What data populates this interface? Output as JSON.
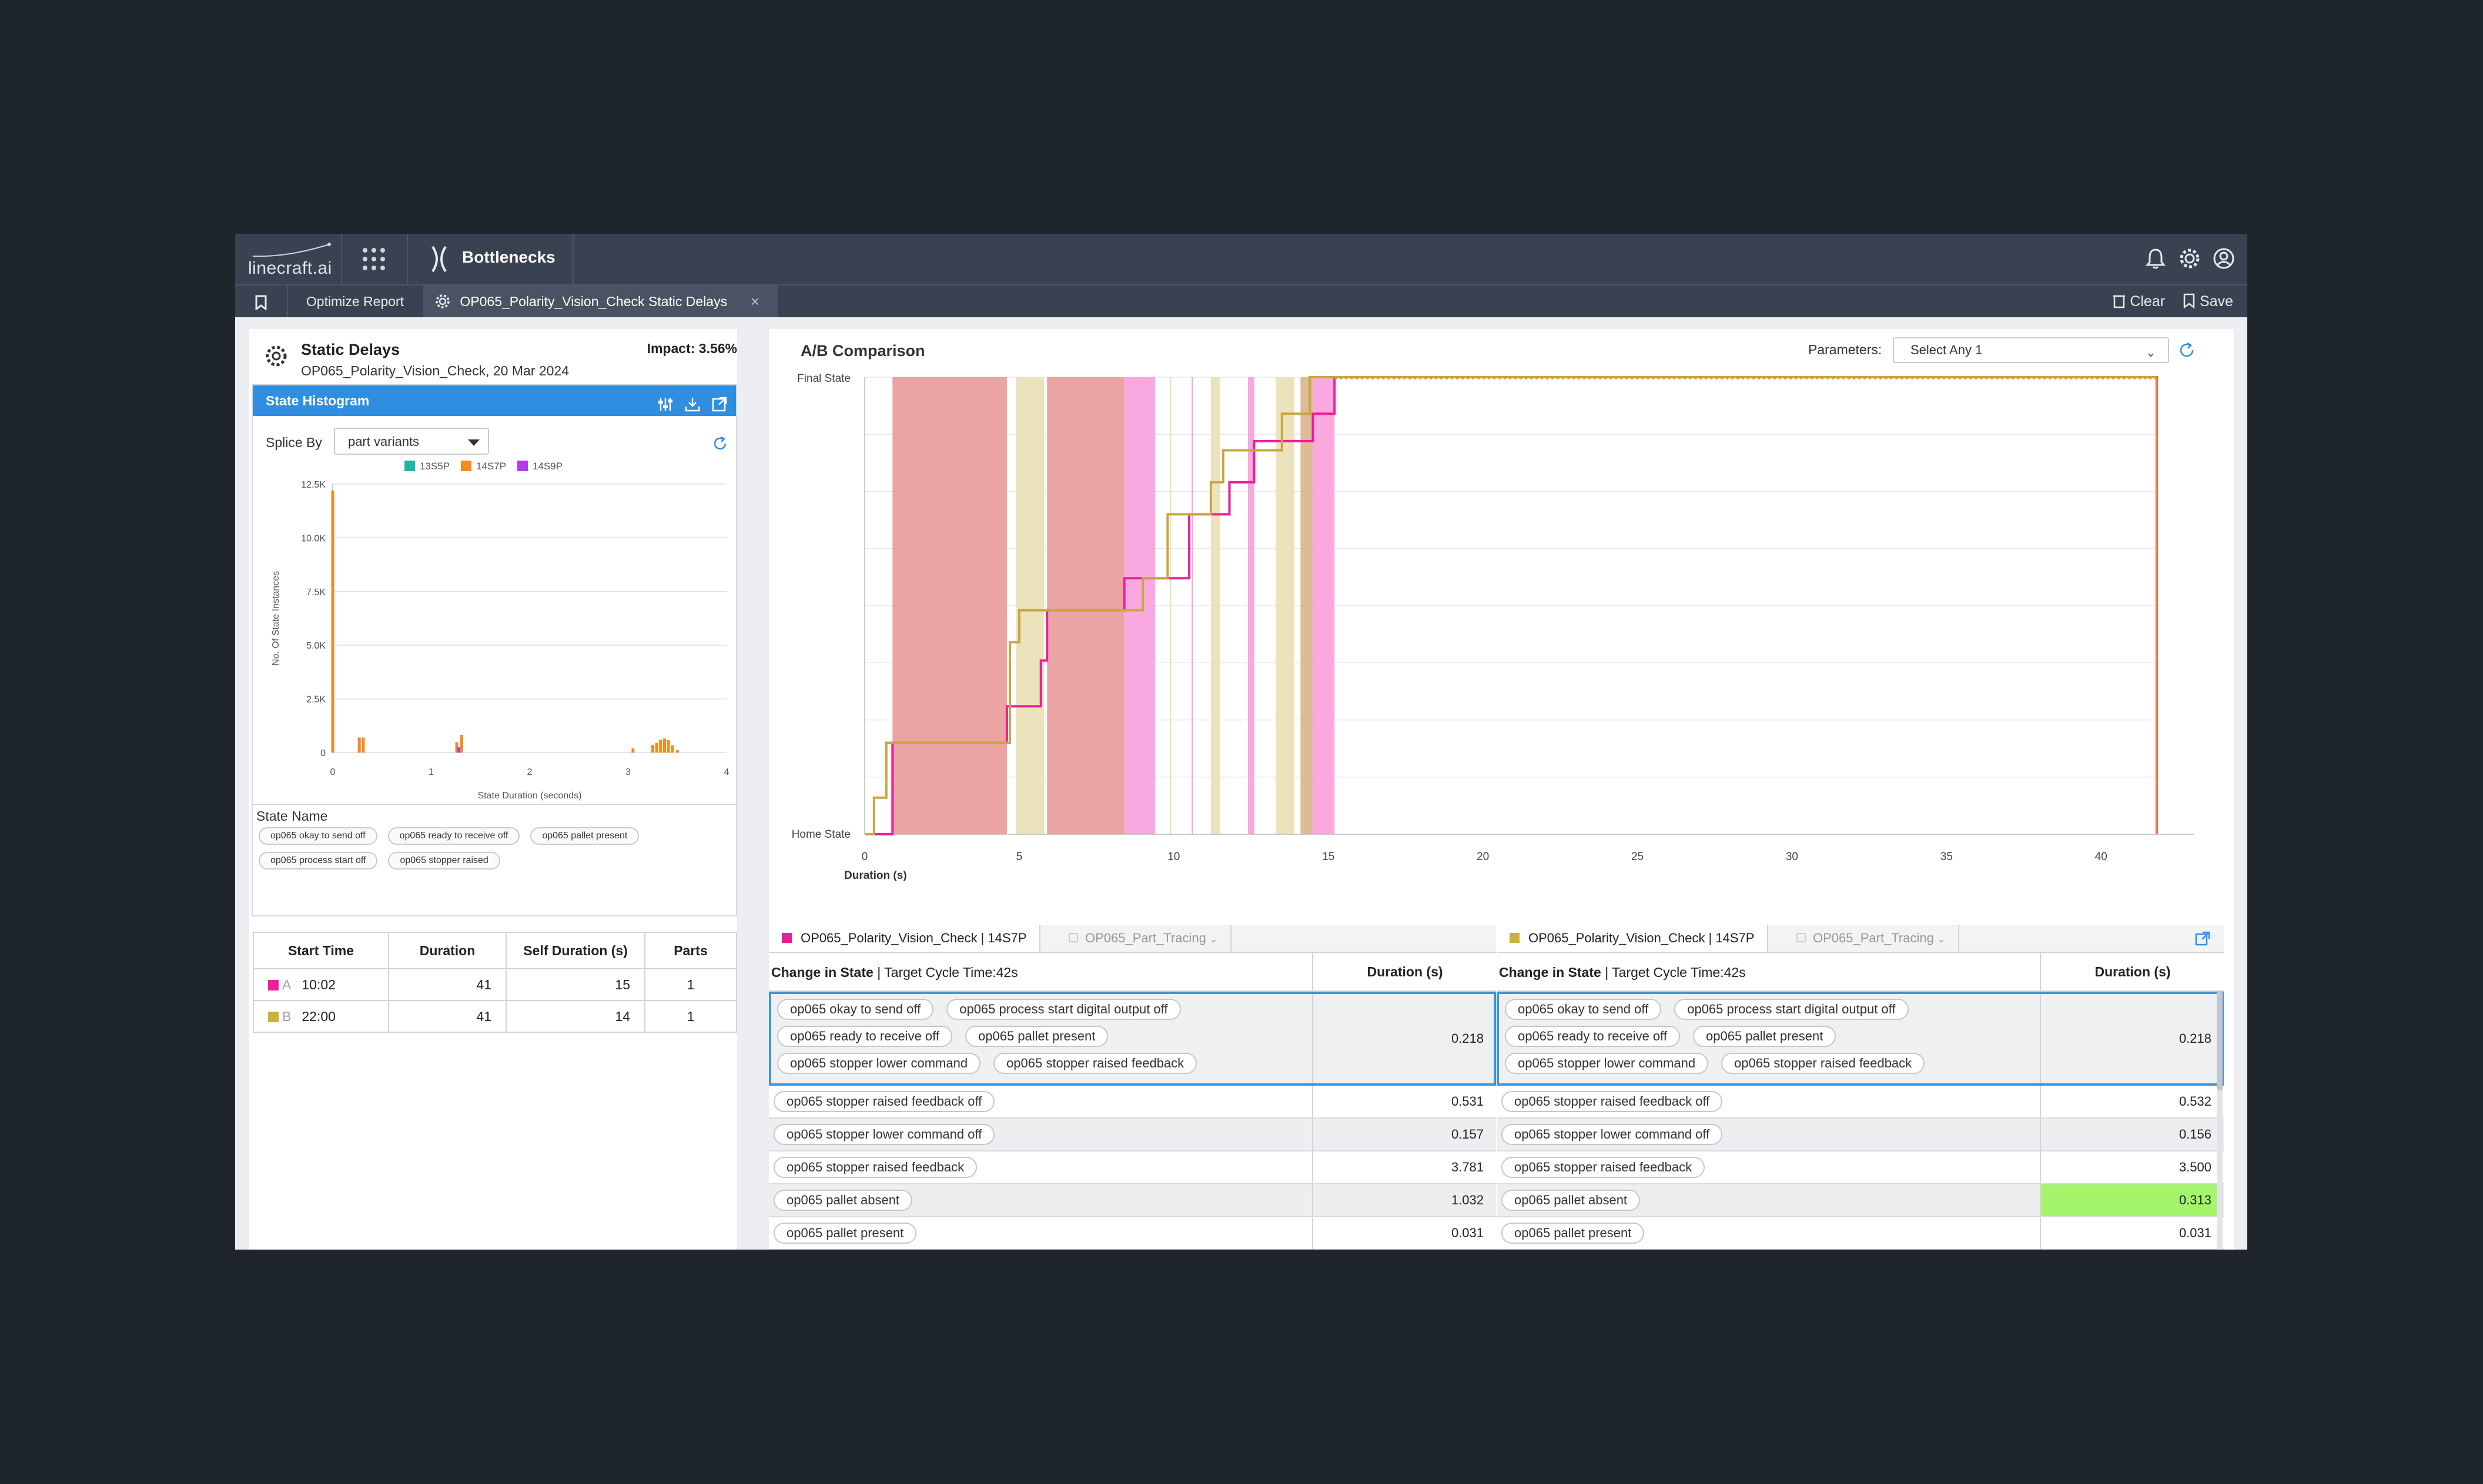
{
  "brand": {
    "logo_text": "linecraft.ai"
  },
  "header": {
    "module_title": "Bottlenecks"
  },
  "tabs": {
    "optimize": "Optimize Report",
    "active": "OP065_Polarity_Vision_Check Static Delays",
    "close": "×",
    "clear": "Clear",
    "save": "Save"
  },
  "static_delays": {
    "title": "Static Delays",
    "subtitle": "OP065_Polarity_Vision_Check, 20 Mar 2024",
    "impact": "Impact: 3.56%"
  },
  "histogram": {
    "header": "State Histogram",
    "splice_label": "Splice By",
    "splice_value": "part variants",
    "chart_data": {
      "type": "bar",
      "title": "",
      "xlabel": "State Duration (seconds)",
      "ylabel": "No. Of State Instances",
      "ylim": [
        0,
        12500
      ],
      "xlim": [
        0,
        4
      ],
      "yticks": [
        "12.5K",
        "10.0K",
        "7.5K",
        "5.0K",
        "2.5K",
        "0"
      ],
      "xticks": [
        "0",
        "1",
        "2",
        "3",
        "4"
      ],
      "legend_position": "top",
      "series": [
        {
          "name": "13S5P",
          "color": "#1bb9a3",
          "points": []
        },
        {
          "name": "14S7P",
          "color": "#f68a1e",
          "points": [
            [
              0.0,
              12200
            ],
            [
              0.27,
              700
            ],
            [
              0.31,
              700
            ],
            [
              1.26,
              480
            ],
            [
              1.31,
              820
            ],
            [
              3.25,
              350
            ],
            [
              3.29,
              450
            ],
            [
              3.33,
              600
            ],
            [
              3.37,
              650
            ],
            [
              3.41,
              580
            ],
            [
              3.45,
              340
            ],
            [
              3.05,
              200
            ],
            [
              3.5,
              120
            ]
          ]
        },
        {
          "name": "14S9P",
          "color": "#b23be8",
          "points": [
            [
              1.28,
              250
            ]
          ]
        }
      ]
    }
  },
  "state_name": {
    "label": "State Name",
    "chips": [
      "op065 okay to send off",
      "op065 ready to receive off",
      "op065 pallet present",
      "op065 process start off",
      "op065 stopper raised"
    ]
  },
  "ab_table": {
    "headers": [
      "Start Time",
      "Duration",
      "Self Duration (s)",
      "Parts"
    ],
    "rows": [
      {
        "label": "A",
        "color": "#ec1f9a",
        "start": "10:02",
        "duration": "41",
        "self": "15",
        "parts": "1"
      },
      {
        "label": "B",
        "color": "#c9b33a",
        "start": "22:00",
        "duration": "41",
        "self": "14",
        "parts": "1"
      }
    ]
  },
  "ab_comparison": {
    "title": "A/B Comparison",
    "params_label": "Parameters:",
    "params_value": "Select Any 1",
    "chart_data": {
      "type": "line",
      "xlabel": "Duration (s)",
      "ylabel": "",
      "xlim": [
        0,
        43
      ],
      "xticks": [
        0,
        5,
        10,
        15,
        20,
        25,
        30,
        35,
        40
      ],
      "ylabels": [
        "Final State",
        "Home State"
      ],
      "series": [
        {
          "name": "A",
          "color": "#ec1f9a",
          "points": [
            [
              0,
              0
            ],
            [
              0.9,
              0
            ],
            [
              0.9,
              0.2
            ],
            [
              4.6,
              0.2
            ],
            [
              4.6,
              0.28
            ],
            [
              4.9,
              0.28
            ],
            [
              4.9,
              0.28
            ],
            [
              5.7,
              0.28
            ],
            [
              5.7,
              0.38
            ],
            [
              5.9,
              0.38
            ],
            [
              5.9,
              0.49
            ],
            [
              8.4,
              0.49
            ],
            [
              8.4,
              0.56
            ],
            [
              9.4,
              0.56
            ],
            [
              9.4,
              0.56
            ],
            [
              10.5,
              0.56
            ],
            [
              10.5,
              0.7
            ],
            [
              11.8,
              0.7
            ],
            [
              11.8,
              0.77
            ],
            [
              12.6,
              0.77
            ],
            [
              12.6,
              0.86
            ],
            [
              13.9,
              0.86
            ],
            [
              13.9,
              0.86
            ],
            [
              14.5,
              0.86
            ],
            [
              14.5,
              0.92
            ],
            [
              15.2,
              0.92
            ],
            [
              15.2,
              1.0
            ],
            [
              41.8,
              1.0
            ],
            [
              41.8,
              0.0
            ]
          ]
        },
        {
          "name": "B",
          "color": "#c9a640",
          "points": [
            [
              0,
              0
            ],
            [
              0.3,
              0
            ],
            [
              0.3,
              0.08
            ],
            [
              0.7,
              0.08
            ],
            [
              0.7,
              0.2
            ],
            [
              4.7,
              0.2
            ],
            [
              4.7,
              0.42
            ],
            [
              5.0,
              0.42
            ],
            [
              5.0,
              0.49
            ],
            [
              9.0,
              0.49
            ],
            [
              9.0,
              0.56
            ],
            [
              9.8,
              0.56
            ],
            [
              9.8,
              0.7
            ],
            [
              11.2,
              0.7
            ],
            [
              11.2,
              0.77
            ],
            [
              11.6,
              0.77
            ],
            [
              11.6,
              0.84
            ],
            [
              13.5,
              0.84
            ],
            [
              13.5,
              0.92
            ],
            [
              14.4,
              0.92
            ],
            [
              14.4,
              1.0
            ],
            [
              41.8,
              1.0
            ]
          ]
        }
      ],
      "bands": [
        {
          "from": 0.9,
          "to": 4.6,
          "color": "#e89a9a"
        },
        {
          "from": 4.9,
          "to": 5.8,
          "color": "#e9e0b5"
        },
        {
          "from": 5.9,
          "to": 8.4,
          "color": "#e89a9a"
        },
        {
          "from": 8.4,
          "to": 9.4,
          "color": "#f8a0dc"
        },
        {
          "from": 11.2,
          "to": 11.5,
          "color": "#e9e0b5"
        },
        {
          "from": 12.4,
          "to": 12.6,
          "color": "#f8a0dc"
        },
        {
          "from": 13.3,
          "to": 13.9,
          "color": "#e9e0b5"
        },
        {
          "from": 14.1,
          "to": 14.5,
          "color": "#d8b48c"
        },
        {
          "from": 14.5,
          "to": 15.2,
          "color": "#f8a0dc"
        }
      ]
    }
  },
  "panel_a": {
    "tab_active": "OP065_Polarity_Vision_Check | 14S7P",
    "tab_other": "OP065_Part_Tracing",
    "sq_color": "#ec1f9a",
    "col1_bold": "Change in State",
    "col1_rest": " | Target Cycle Time:42s",
    "col2": "Duration (s)",
    "selected_chips": [
      "op065 okay to send off",
      "op065 process start digital output off",
      "op065 ready to receive off",
      "op065 pallet present",
      "op065 stopper lower command",
      "op065 stopper raised feedback"
    ],
    "selected_duration": "0.218",
    "rows": [
      {
        "state": "op065 stopper raised feedback off",
        "duration": "0.531"
      },
      {
        "state": "op065 stopper lower command off",
        "duration": "0.157"
      },
      {
        "state": "op065 stopper raised feedback",
        "duration": "3.781"
      },
      {
        "state": "op065 pallet absent",
        "duration": "1.032"
      },
      {
        "state": "op065 pallet present",
        "duration": "0.031"
      }
    ]
  },
  "panel_b": {
    "tab_active": "OP065_Polarity_Vision_Check | 14S7P",
    "tab_other": "OP065_Part_Tracing",
    "sq_color": "#c9b33a",
    "col1_bold": "Change in State",
    "col1_rest": " | Target Cycle Time:42s",
    "col2": "Duration (s)",
    "selected_chips": [
      "op065 okay to send off",
      "op065 process start digital output off",
      "op065 ready to receive off",
      "op065 pallet present",
      "op065 stopper lower command",
      "op065 stopper raised feedback"
    ],
    "selected_duration": "0.218",
    "rows": [
      {
        "state": "op065 stopper raised feedback off",
        "duration": "0.532"
      },
      {
        "state": "op065 stopper lower command off",
        "duration": "0.156"
      },
      {
        "state": "op065 stopper raised feedback",
        "duration": "3.500"
      },
      {
        "state": "op065 pallet absent",
        "duration": "0.313",
        "highlight": true
      },
      {
        "state": "op065 pallet present",
        "duration": "0.031"
      }
    ]
  }
}
